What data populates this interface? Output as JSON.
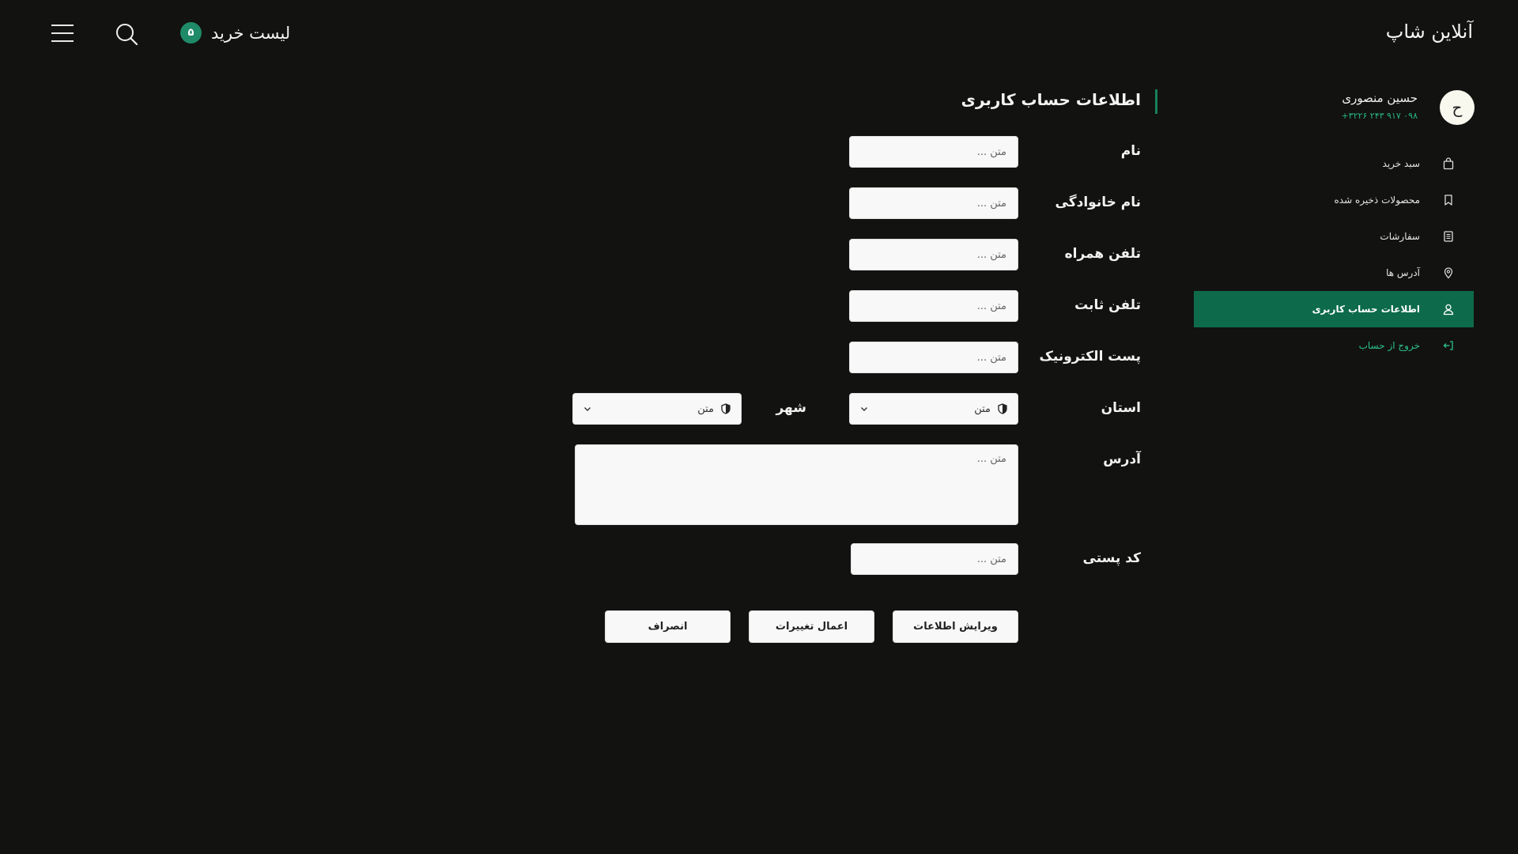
{
  "header": {
    "brand": "آنلاین شاپ",
    "cart_label": "لیست خرید",
    "cart_count": "۵",
    "search_icon": "search-icon",
    "menu_icon": "hamburger-menu-icon"
  },
  "profile": {
    "avatar_initial": "ح",
    "name": "حسین منصوری",
    "phone": "۰۹۸ ۹۱۷ ۲۴۳ ۳۲۲۶+"
  },
  "sidebar": {
    "items": [
      {
        "label": "سبد خرید",
        "icon": "shopping-bag-icon"
      },
      {
        "label": "محصولات ذخیره شده",
        "icon": "bookmark-icon"
      },
      {
        "label": "سفارشات",
        "icon": "receipt-icon"
      },
      {
        "label": "آدرس ها",
        "icon": "location-pin-icon"
      },
      {
        "label": "اطلاعات حساب کاربری",
        "icon": "user-icon",
        "active": true
      },
      {
        "label": "خروج از حساب",
        "icon": "logout-icon"
      }
    ]
  },
  "form": {
    "title": "اطلاعات حساب کاربری",
    "first_name_label": "نام",
    "last_name_label": "نام خانوادگی",
    "mobile_label": "تلفن همراه",
    "landline_label": "تلفن ثابت",
    "email_label": "پست الکترونیک",
    "province_label": "استان",
    "city_label": "شهر",
    "address_label": "آدرس",
    "postal_label": "کد پستی",
    "placeholder": "متن ...",
    "select_value": "متن"
  },
  "buttons": {
    "edit": "ویرایش اطلاعات",
    "apply": "اعمال تغییرات",
    "cancel": "انصراف"
  },
  "colors": {
    "background": "#121210",
    "accent": "#0d6b4c",
    "accent_light": "#1f8a68",
    "phone_text": "#27b585"
  }
}
